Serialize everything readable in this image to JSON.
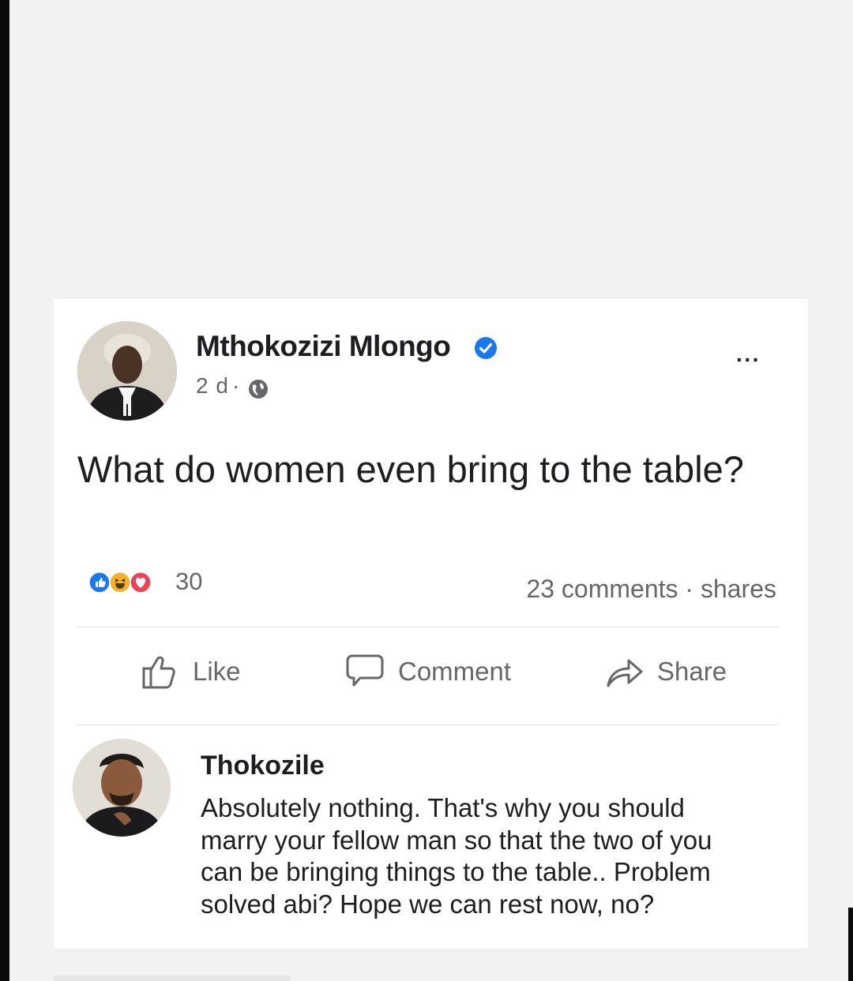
{
  "post": {
    "author": "Mthokozizi Mlongo",
    "time": "2 d",
    "separator": "·",
    "more_label": "···",
    "text": "What do women even bring to the table?",
    "reaction_count": "30",
    "reactions": [
      "like-reaction-icon",
      "haha-reaction-icon",
      "love-reaction-icon"
    ],
    "comments_label": "23 comments",
    "shares_separator": " · ",
    "shares_label": "shares"
  },
  "actions": {
    "like": "Like",
    "comment": "Comment",
    "share": "Share"
  },
  "comment": {
    "author": "Thokozile",
    "text": "Absolutely nothing. That's why you should marry your fellow man so that the two of you can be bringing things to the table.. Problem solved abi? Hope we can rest now, no?"
  },
  "colors": {
    "verified_blue": "#1877f2",
    "text": "#1c1e21",
    "secondary_text": "#65676b",
    "love_red": "#f33e58",
    "haha_yellow": "#f7b125"
  }
}
